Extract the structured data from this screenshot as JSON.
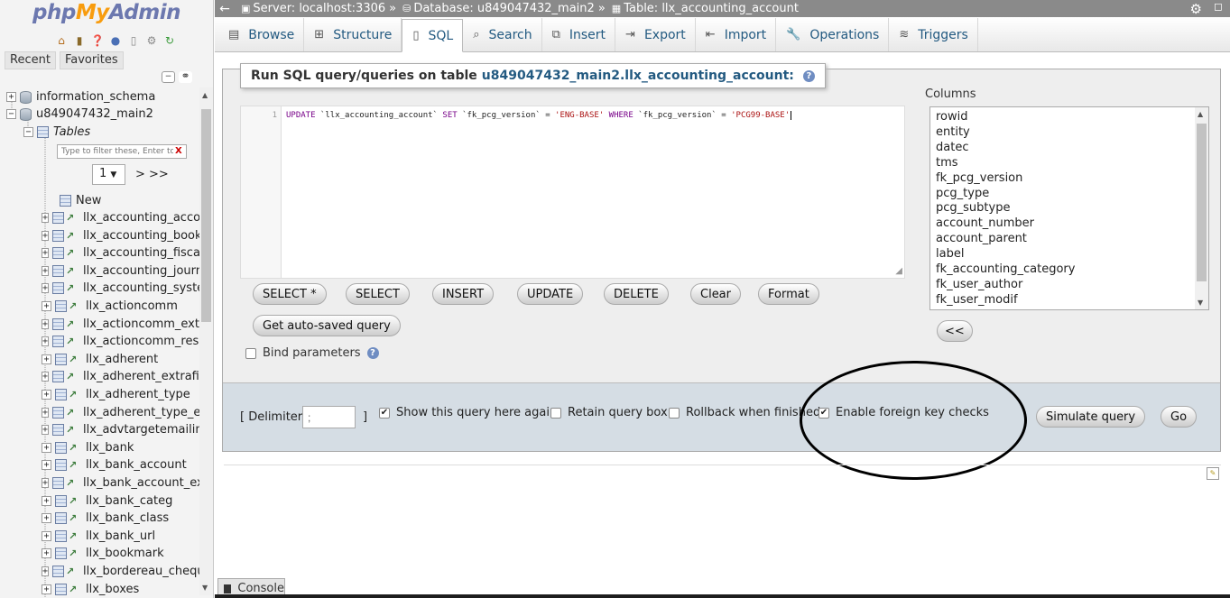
{
  "nav": {
    "logo": {
      "php": "php",
      "my": "My",
      "admin": "Admin"
    },
    "icons": [
      "home-icon",
      "exit-icon",
      "help-icon",
      "docs-icon",
      "copy-icon",
      "gear-icon",
      "reload-icon"
    ],
    "tabs": {
      "recent": "Recent",
      "favorites": "Favorites"
    },
    "databases": [
      "information_schema",
      "u849047432_main2"
    ],
    "tables_label": "Tables",
    "filter_placeholder": "Type to filter these, Enter to search all",
    "filter_clear": "X",
    "page_value": "1",
    "page_next": "> >>",
    "new_label": "New",
    "tables": [
      "llx_accounting_account",
      "llx_accounting_bookkeeping",
      "llx_accounting_fiscalyear",
      "llx_accounting_journal",
      "llx_accounting_system",
      "llx_actioncomm",
      "llx_actioncomm_extrafields",
      "llx_actioncomm_resources",
      "llx_adherent",
      "llx_adherent_extrafields",
      "llx_adherent_type",
      "llx_adherent_type_extrafields",
      "llx_advtargetemailing",
      "llx_bank",
      "llx_bank_account",
      "llx_bank_account_extrafields",
      "llx_bank_categ",
      "llx_bank_class",
      "llx_bank_url",
      "llx_bookmark",
      "llx_bordereau_cheque",
      "llx_boxes"
    ]
  },
  "breadcrumb": {
    "server": "Server: localhost:3306",
    "database": "Database: u849047432_main2",
    "table": "Table: llx_accounting_account",
    "sep": "»"
  },
  "tabs": [
    {
      "label": "Browse",
      "icon": "browse-icon"
    },
    {
      "label": "Structure",
      "icon": "structure-icon"
    },
    {
      "label": "SQL",
      "icon": "sql-icon"
    },
    {
      "label": "Search",
      "icon": "search-icon"
    },
    {
      "label": "Insert",
      "icon": "insert-icon"
    },
    {
      "label": "Export",
      "icon": "export-icon"
    },
    {
      "label": "Import",
      "icon": "import-icon"
    },
    {
      "label": "Operations",
      "icon": "operations-icon"
    },
    {
      "label": "Triggers",
      "icon": "triggers-icon"
    }
  ],
  "sql": {
    "legend_prefix": "Run SQL query/queries on table",
    "legend_table": "u849047432_main2.llx_accounting_account:",
    "line_number": "1",
    "code": {
      "k1": "UPDATE",
      "t1": " `llx_accounting_account` ",
      "k2": "SET",
      "t2": " `fk_pcg_version` = ",
      "s1": "'ENG-BASE'",
      "t3": " ",
      "k3": "WHERE",
      "t4": " `fk_pcg_version` = ",
      "s2": "'PCG99-BASE'"
    },
    "buttons": {
      "select_star": "SELECT *",
      "select": "SELECT",
      "insert": "INSERT",
      "update": "UPDATE",
      "delete": "DELETE",
      "clear": "Clear",
      "format": "Format",
      "autosaved": "Get auto-saved query"
    },
    "bind_parameters": "Bind parameters",
    "columns_label": "Columns",
    "columns": [
      "rowid",
      "entity",
      "datec",
      "tms",
      "fk_pcg_version",
      "pcg_type",
      "pcg_subtype",
      "account_number",
      "account_parent",
      "label",
      "fk_accounting_category",
      "fk_user_author",
      "fk_user_modif"
    ],
    "insert_column_button": "<<"
  },
  "options": {
    "delimiter_open": "[ Delimiter",
    "delimiter_value": ";",
    "delimiter_close": "]",
    "show_query_again": {
      "label": "Show this query here again",
      "checked": true
    },
    "retain_query_box": {
      "label": "Retain query box",
      "checked": false
    },
    "rollback_when_finished": {
      "label": "Rollback when finished",
      "checked": false
    },
    "enable_foreign_key_checks": {
      "label": "Enable foreign key checks",
      "checked": true
    },
    "simulate_button": "Simulate query",
    "go_button": "Go"
  },
  "console": {
    "label": "Console"
  }
}
